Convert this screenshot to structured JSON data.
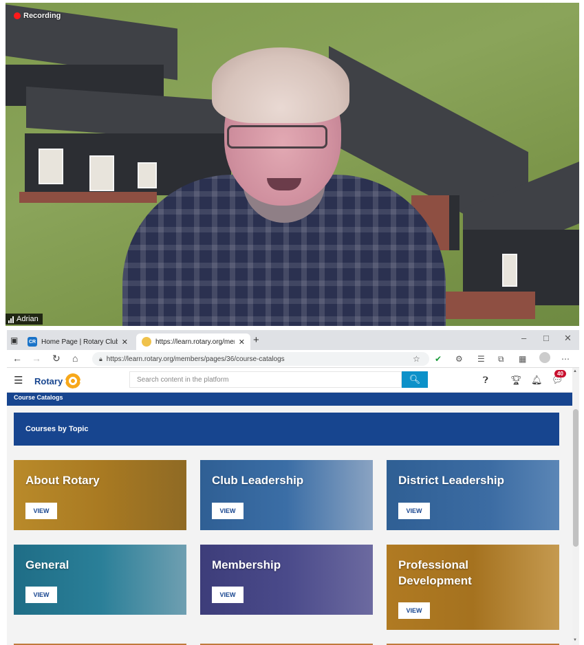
{
  "video": {
    "recording_label": "Recording",
    "participant_name": "Adrian"
  },
  "browser": {
    "tabs": [
      {
        "favicon": "CR",
        "title": "Home Page | Rotary Club of Pen",
        "active": false
      },
      {
        "favicon": "",
        "title": "https://learn.rotary.org/member",
        "active": true
      }
    ],
    "url": "https://learn.rotary.org/members/pages/36/course-catalogs"
  },
  "site": {
    "logo_text": "Rotary",
    "search_placeholder": "Search content in the platform",
    "notification_count": "40",
    "breadcrumb": "Course Catalogs",
    "section_title": "Courses by Topic",
    "view_label": "VIEW",
    "cards": [
      {
        "title": "About Rotary",
        "color": "#b98a2a"
      },
      {
        "title": "Club Leadership",
        "color": "#2f5f94"
      },
      {
        "title": "District Leadership",
        "color": "#2f5f94"
      },
      {
        "title": "General",
        "color": "#1f6d86"
      },
      {
        "title": "Membership",
        "color": "#3d3d7a"
      },
      {
        "title": "Professional Development",
        "color": "#b07a22"
      }
    ]
  }
}
